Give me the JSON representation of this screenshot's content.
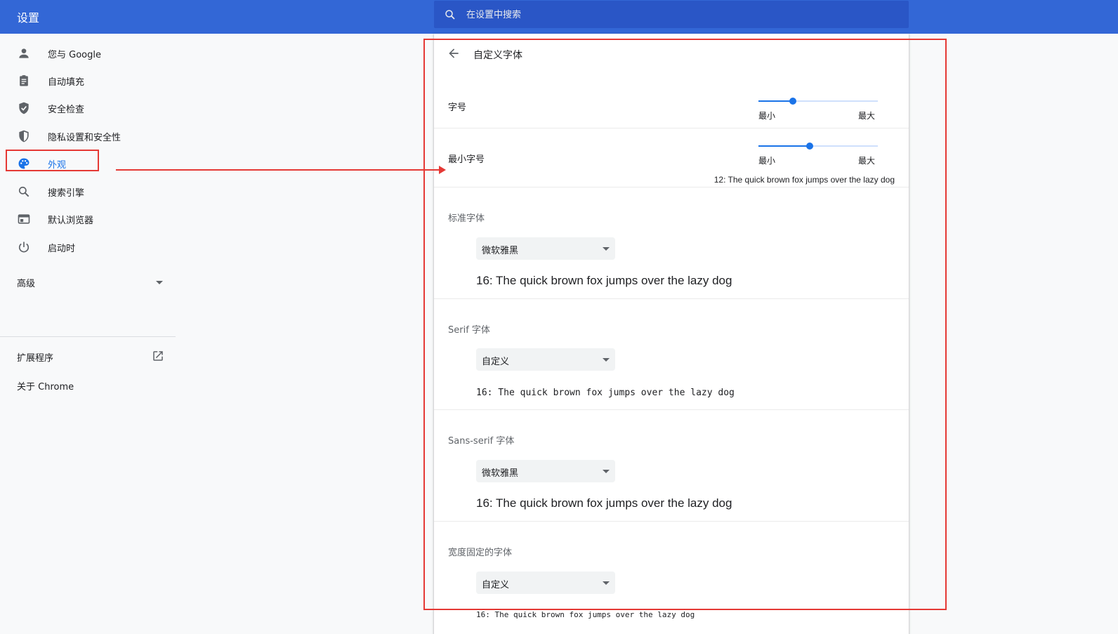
{
  "header": {
    "title": "设置"
  },
  "search": {
    "placeholder": "在设置中搜索"
  },
  "sidebar": {
    "items": [
      {
        "label": "您与 Google",
        "icon": "person-icon"
      },
      {
        "label": "自动填充",
        "icon": "clipboard-icon"
      },
      {
        "label": "安全检查",
        "icon": "shield-check-icon"
      },
      {
        "label": "隐私设置和安全性",
        "icon": "shield-icon"
      },
      {
        "label": "外观",
        "icon": "palette-icon",
        "active": true
      },
      {
        "label": "搜索引擎",
        "icon": "search-icon"
      },
      {
        "label": "默认浏览器",
        "icon": "browser-icon"
      },
      {
        "label": "启动时",
        "icon": "power-icon"
      }
    ],
    "advanced": "高级",
    "extensions": "扩展程序",
    "about": "关于 Chrome"
  },
  "page": {
    "title": "自定义字体",
    "font_size": {
      "label": "字号",
      "min_label": "最小",
      "max_label": "最大",
      "value_fraction": 0.29
    },
    "min_font_size": {
      "label": "最小字号",
      "min_label": "最小",
      "max_label": "最大",
      "value_fraction": 0.43,
      "preview": "12: The quick brown fox jumps over the lazy dog"
    },
    "standard_font": {
      "label": "标准字体",
      "value": "微软雅黑",
      "preview": "16: The quick brown fox jumps over the lazy dog"
    },
    "serif_font": {
      "label": "Serif 字体",
      "value": "自定义",
      "preview": "16: The quick brown fox jumps over the lazy dog"
    },
    "sans_serif_font": {
      "label": "Sans-serif 字体",
      "value": "微软雅黑",
      "preview": "16: The quick brown fox jumps over the lazy dog"
    },
    "fixed_width_font": {
      "label": "宽度固定的字体",
      "value": "自定义",
      "preview": "16: The quick brown fox jumps over the lazy dog"
    }
  },
  "colors": {
    "header_bg": "#3367d6",
    "accent": "#1a73e8",
    "highlight": "#e53935"
  }
}
